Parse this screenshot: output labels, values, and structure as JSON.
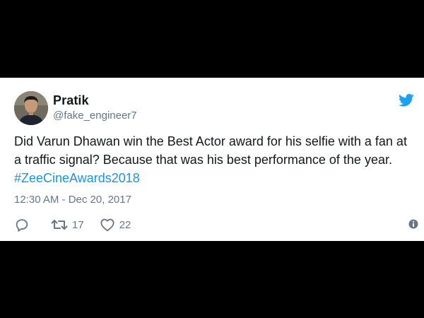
{
  "tweet": {
    "author": {
      "display_name": "Pratik",
      "handle": "@fake_engineer7"
    },
    "text": {
      "body": "Did Varun Dhawan win the Best Actor award for his selfie with a fan at a traffic signal? Because that was his best performance of the year. ",
      "hashtag": "#ZeeCineAwards2018"
    },
    "timestamp": "12:30 AM - Dec 20, 2017",
    "actions": {
      "reply_icon": "reply-icon",
      "retweet_icon": "retweet-icon",
      "retweet_count": "17",
      "like_icon": "heart-icon",
      "like_count": "22",
      "info_icon": "info-icon"
    },
    "brand_icon": "twitter-bird-icon"
  },
  "colors": {
    "background": "#000000",
    "card": "#ffffff",
    "text_primary": "#14171a",
    "text_secondary": "#657786",
    "link": "#1b95e0",
    "twitter_blue": "#1da1f2"
  }
}
